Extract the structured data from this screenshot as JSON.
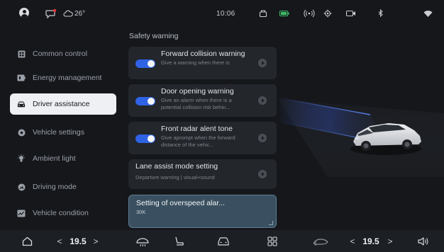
{
  "status_bar": {
    "weather": "26°",
    "time": "10:06"
  },
  "sidebar": {
    "items": [
      {
        "label": "Common control",
        "icon": "grid-icon"
      },
      {
        "label": "Energy management",
        "icon": "battery-icon"
      },
      {
        "label": "Driver assistance",
        "icon": "car-front-icon",
        "active": true
      },
      {
        "label": "Vehicle settings",
        "icon": "settings-icon"
      },
      {
        "label": "Ambient light",
        "icon": "bulb-icon"
      },
      {
        "label": "Driving mode",
        "icon": "gauge-icon"
      },
      {
        "label": "Vehicle condition",
        "icon": "chart-icon"
      }
    ]
  },
  "main": {
    "section_title": "Safety warning",
    "cards": [
      {
        "title": "Forward collision warning",
        "desc": "Give a warning when there is",
        "toggle_on": true
      },
      {
        "title": "Door opening warning",
        "desc": "Give an alarm when there is a potential collision risk behin...",
        "toggle_on": true
      },
      {
        "title": "Front radar alent tone",
        "desc": "Give aprompt when the forward distance of the vehic...",
        "toggle_on": true
      },
      {
        "title": "Lane assist mode setting",
        "desc": "Departure warning | visual+sound"
      },
      {
        "title": "Setting of overspeed alar...",
        "desc": "30K"
      }
    ]
  },
  "dock": {
    "left_temp": "19.5",
    "right_temp": "19.5",
    "chevron_left": "<",
    "chevron_right": ">"
  },
  "colors": {
    "accent": "#2f63e6",
    "active_bg": "#eef0f3",
    "card_bg": "#23262b",
    "input_bg": "#3a5060"
  }
}
